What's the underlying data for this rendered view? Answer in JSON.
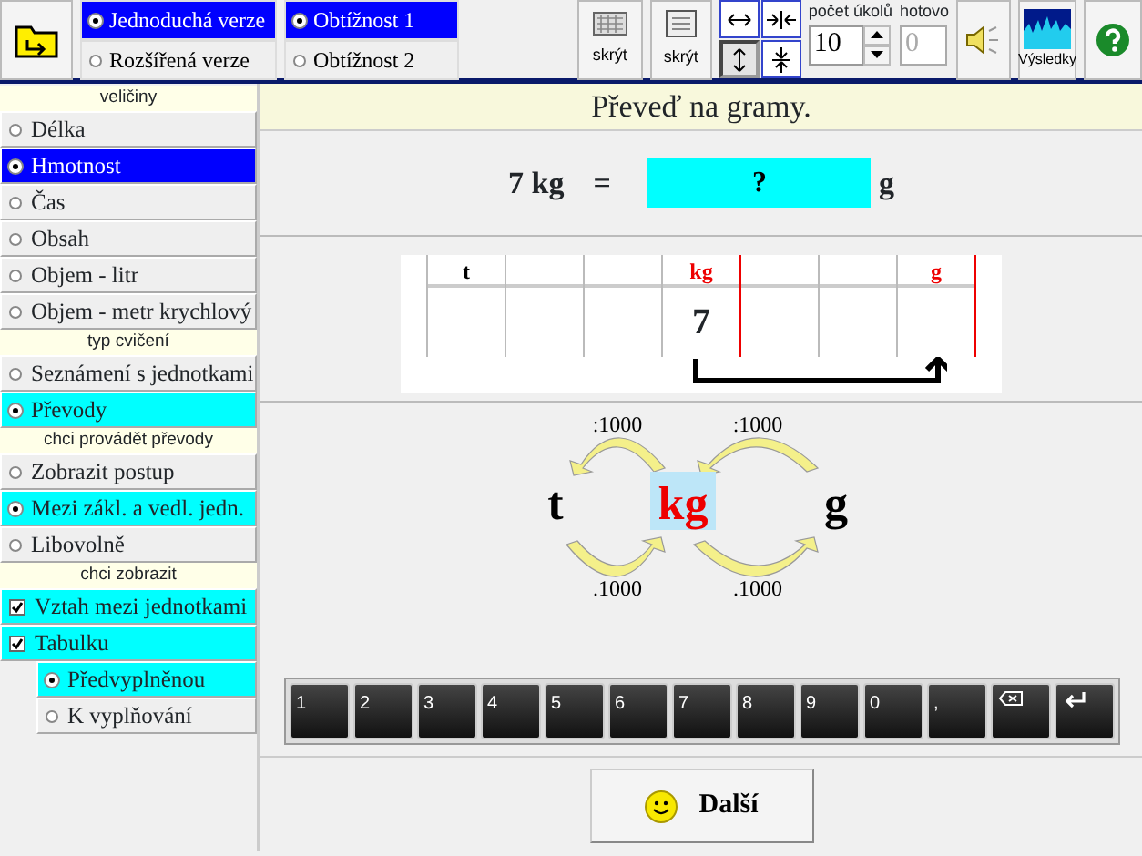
{
  "toolbar": {
    "version_options": [
      {
        "label": "Jednoduchá verze",
        "selected": true
      },
      {
        "label": "Rozšířená verze",
        "selected": false
      }
    ],
    "difficulty_options": [
      {
        "label": "Obtížnost 1",
        "selected": true
      },
      {
        "label": "Obtížnost 2",
        "selected": false
      }
    ],
    "keyboard_toggle": {
      "label": "skrýt"
    },
    "panel_toggle": {
      "label": "skrýt"
    },
    "layout_buttons": [
      {
        "kind": "expand-h",
        "selected": false
      },
      {
        "kind": "shrink-h",
        "selected": false
      },
      {
        "kind": "expand-v",
        "selected": true
      },
      {
        "kind": "shrink-v",
        "selected": false
      }
    ],
    "task_count": {
      "label": "počet úkolů",
      "value": "10"
    },
    "done": {
      "label": "hotovo",
      "value": "0",
      "disabled": true
    },
    "results_button": {
      "label": "Výsledky"
    }
  },
  "sidebar": {
    "sections": [
      {
        "title": "veličiny",
        "items": [
          {
            "kind": "radio",
            "label": "Délka",
            "selected": false
          },
          {
            "kind": "radio",
            "label": "Hmotnost",
            "selected": true
          },
          {
            "kind": "radio",
            "label": "Čas",
            "selected": false
          },
          {
            "kind": "radio",
            "label": "Obsah",
            "selected": false
          },
          {
            "kind": "radio",
            "label": "Objem - litr",
            "selected": false
          },
          {
            "kind": "radio",
            "label": "Objem - metr krychlový",
            "selected": false
          }
        ]
      },
      {
        "title": "typ cvičení",
        "items": [
          {
            "kind": "radio",
            "label": "Seznámení s jednotkami",
            "selected": false
          },
          {
            "kind": "radio",
            "label": "Převody",
            "selected": true
          }
        ]
      },
      {
        "title": "chci provádět převody",
        "items": [
          {
            "kind": "radio",
            "label": "Zobrazit postup",
            "selected": false
          },
          {
            "kind": "radio",
            "label": "Mezi zákl. a vedl. jedn.",
            "selected": true
          },
          {
            "kind": "radio",
            "label": "Libovolně",
            "selected": false
          }
        ]
      },
      {
        "title": "chci zobrazit",
        "items": [
          {
            "kind": "checkbox",
            "label": "Vztah mezi jednotkami",
            "checked": true
          },
          {
            "kind": "checkbox",
            "label": "Tabulku",
            "checked": true,
            "children": [
              {
                "kind": "radio",
                "label": "Předvyplněnou",
                "selected": true
              },
              {
                "kind": "radio",
                "label": "K vyplňování",
                "selected": false
              }
            ]
          }
        ]
      }
    ]
  },
  "task": {
    "title": "Převeď na gramy.",
    "quantity": "7 kg",
    "equals": "=",
    "answer_placeholder": "?",
    "unit": "g"
  },
  "table": {
    "columns": [
      {
        "header": "t",
        "marked": false
      },
      {
        "marked": false
      },
      {
        "marked": false
      },
      {
        "header": "kg",
        "marked": true,
        "value": "7"
      },
      {
        "marked": false
      },
      {
        "marked": false
      },
      {
        "header": "g",
        "marked": true
      }
    ]
  },
  "diagram": {
    "units": [
      {
        "label": "t",
        "selected": false
      },
      {
        "label": "kg",
        "selected": true
      },
      {
        "label": "g",
        "selected": false
      }
    ],
    "divide_labels": [
      ":1000",
      ":1000"
    ],
    "multiply_labels": [
      ".1000",
      ".1000"
    ]
  },
  "keypad": [
    {
      "kind": "char",
      "label": "1"
    },
    {
      "kind": "char",
      "label": "2"
    },
    {
      "kind": "char",
      "label": "3"
    },
    {
      "kind": "char",
      "label": "4"
    },
    {
      "kind": "char",
      "label": "5"
    },
    {
      "kind": "char",
      "label": "6"
    },
    {
      "kind": "char",
      "label": "7"
    },
    {
      "kind": "char",
      "label": "8"
    },
    {
      "kind": "char",
      "label": "9"
    },
    {
      "kind": "char",
      "label": "0"
    },
    {
      "kind": "char",
      "label": ","
    },
    {
      "kind": "backspace"
    },
    {
      "kind": "enter"
    }
  ],
  "next_button": {
    "label": "Další"
  }
}
